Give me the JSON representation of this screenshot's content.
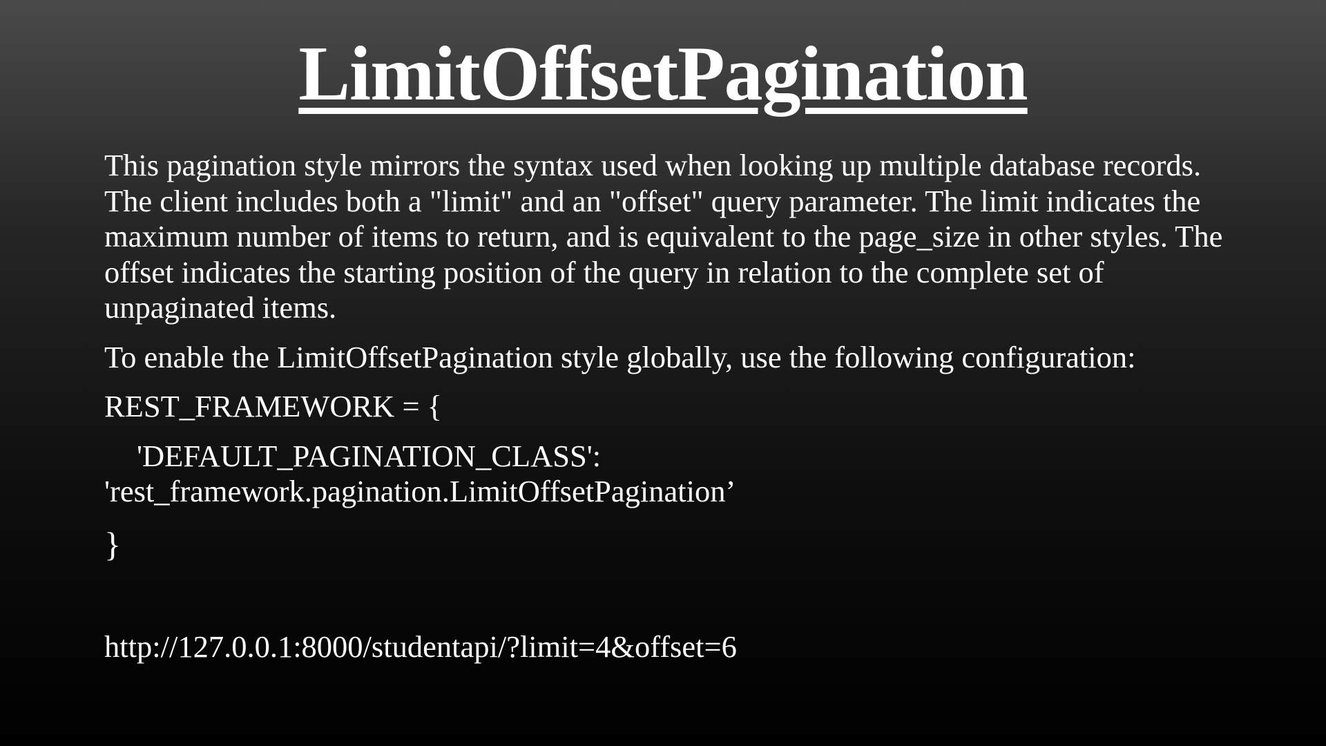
{
  "slide": {
    "title": "LimitOffsetPagination",
    "paragraph_1": "This pagination style mirrors the syntax used when looking up multiple database records. The client includes both a \"limit\" and an \"offset\" query parameter. The limit indicates the maximum number of items to return, and is equivalent to the page_size in other styles. The offset indicates the starting position of the query in relation to the complete set of unpaginated items.",
    "paragraph_2": "To enable the LimitOffsetPagination style globally, use the following configuration:",
    "code": {
      "open": "REST_FRAMEWORK = {",
      "key": "'DEFAULT_PAGINATION_CLASS':",
      "value": "'rest_framework.pagination.LimitOffsetPagination’",
      "close": "}"
    },
    "url": "http://127.0.0.1:8000/studentapi/?limit=4&offset=6"
  }
}
